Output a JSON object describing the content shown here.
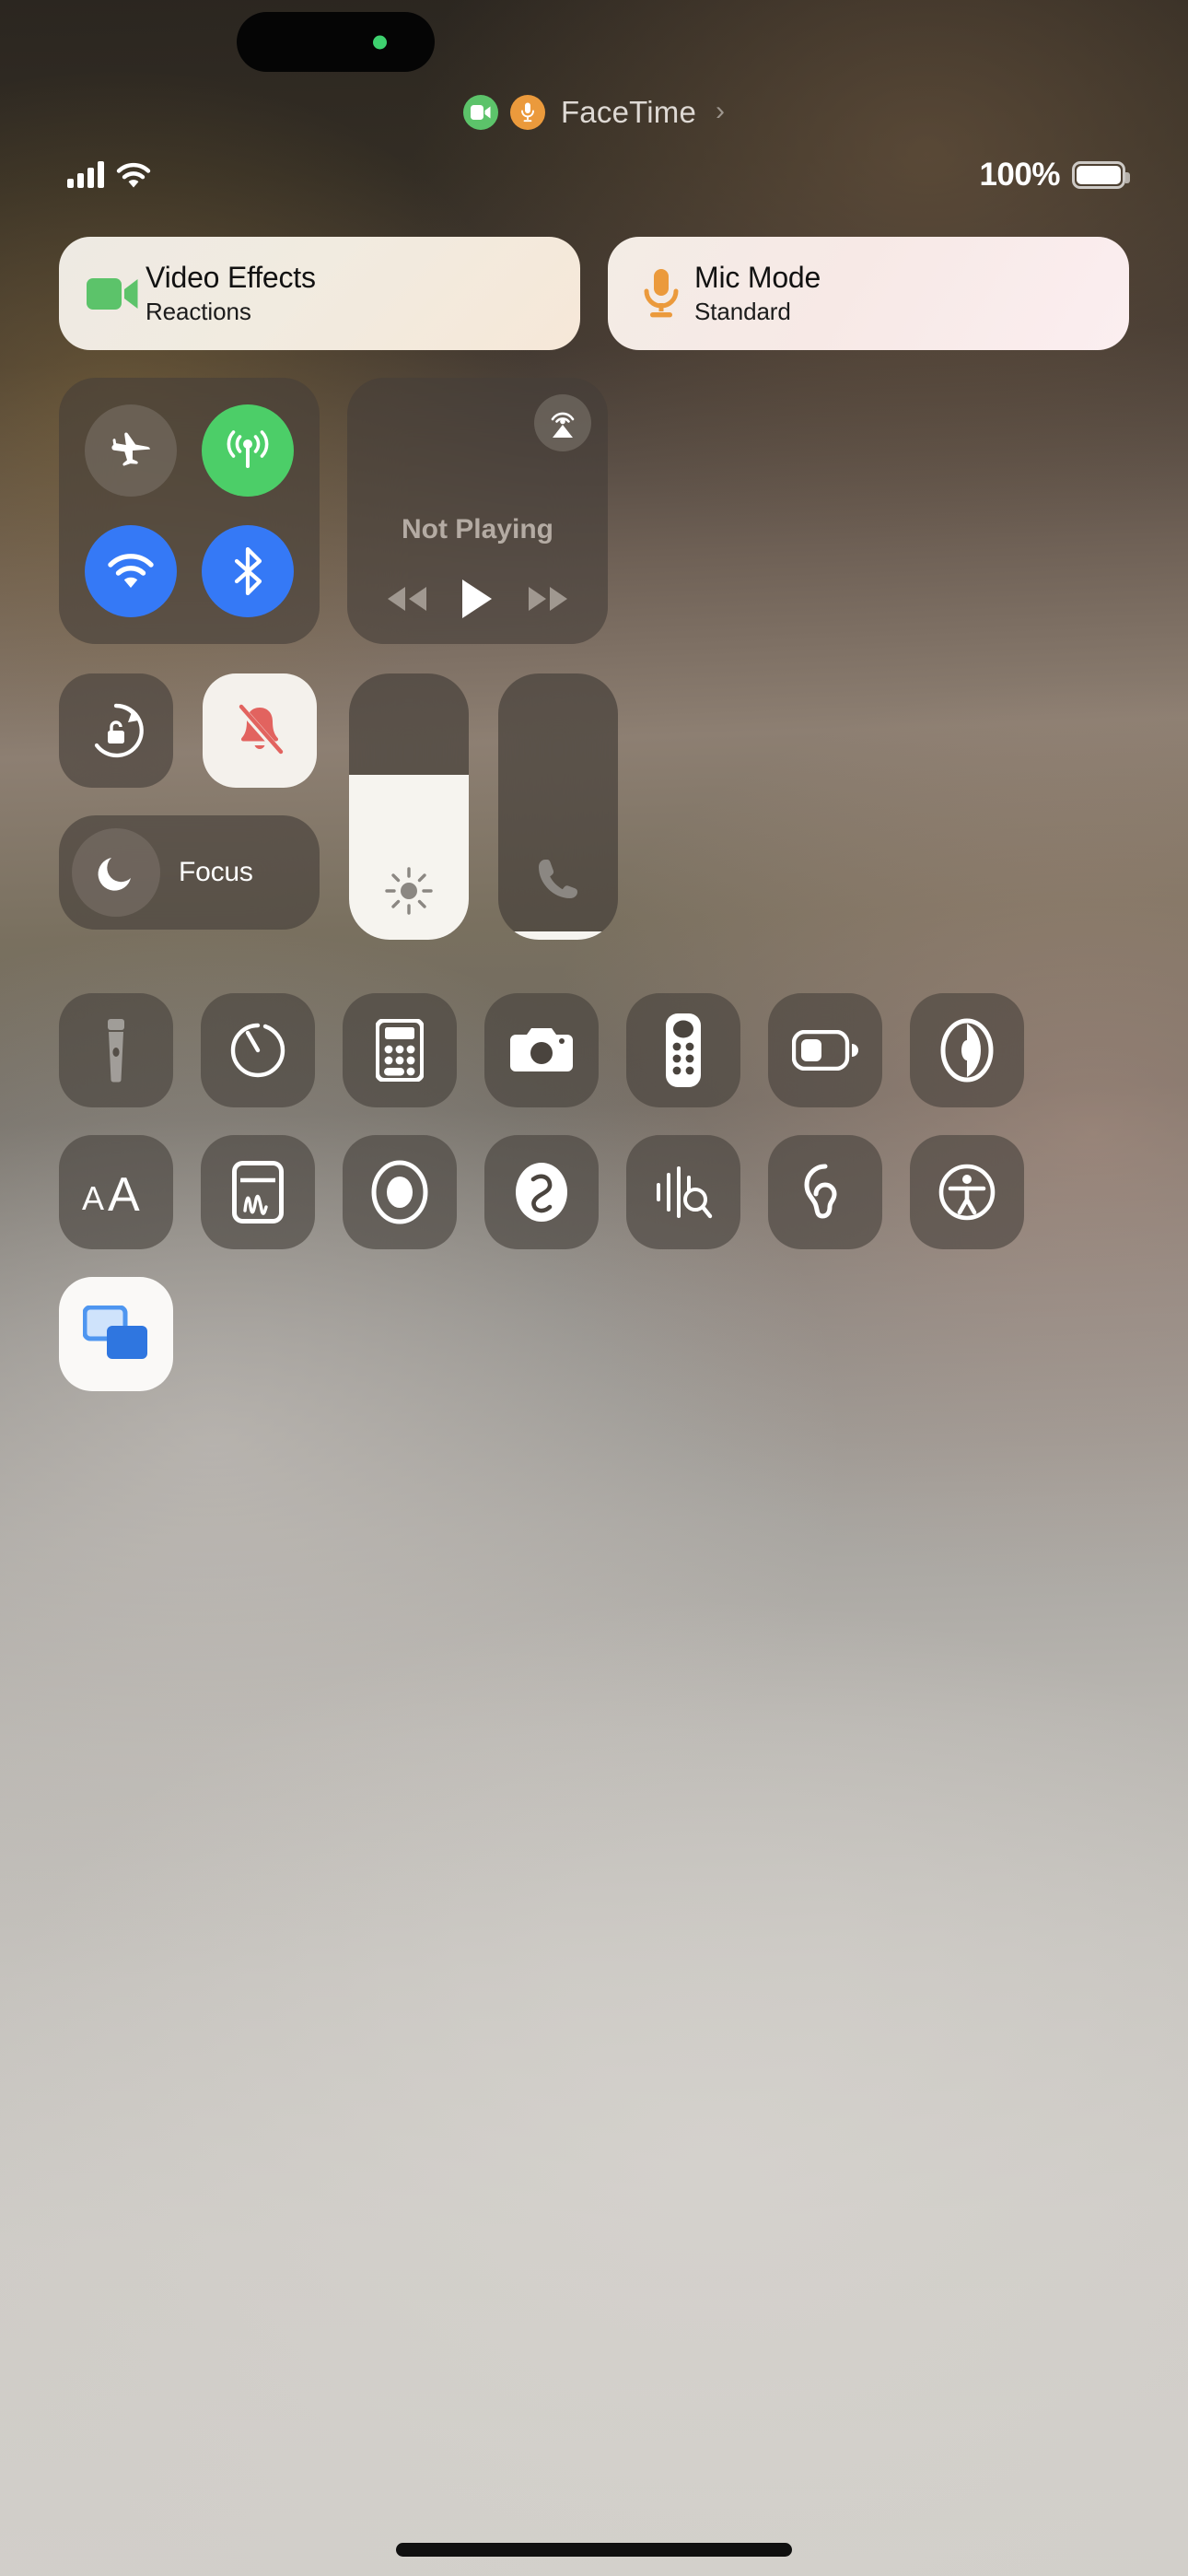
{
  "device": {
    "status_bar": {
      "signal_icon": "cellular-bars-icon",
      "signal_bars": 4,
      "wifi_icon": "wifi-icon",
      "battery_percent": "100%",
      "battery_icon": "battery-full-icon",
      "battery_level": 100
    },
    "dynamic_island": {
      "indicator": "camera-active-dot",
      "indicator_color": "#3ed16f"
    },
    "home_indicator": "home-indicator-bar"
  },
  "live_activity": {
    "app_name": "FaceTime",
    "camera_icon": "video-camera-icon",
    "camera_color": "#5cc36a",
    "mic_icon": "microphone-icon",
    "mic_color": "#eb9a3c",
    "chevron": "›"
  },
  "call_controls": [
    {
      "id": "video-effects",
      "title": "Video Effects",
      "subtitle": "Reactions",
      "icon": "video-camera-icon",
      "icon_color": "#5cc36a"
    },
    {
      "id": "mic-mode",
      "title": "Mic Mode",
      "subtitle": "Standard",
      "icon": "microphone-icon",
      "icon_color": "#eb9a3c"
    }
  ],
  "connectivity": {
    "toggles": [
      {
        "id": "airplane-mode",
        "label": "Airplane Mode",
        "icon": "airplane-icon",
        "state": "off",
        "color": "#847c74"
      },
      {
        "id": "cellular-data",
        "label": "Cellular Data",
        "icon": "cellular-antenna-icon",
        "state": "on",
        "color": "#4cce68"
      },
      {
        "id": "wifi",
        "label": "Wi-Fi",
        "icon": "wifi-icon",
        "state": "on",
        "color": "#3579f6"
      },
      {
        "id": "bluetooth",
        "label": "Bluetooth",
        "icon": "bluetooth-icon",
        "state": "on",
        "color": "#3579f6"
      }
    ]
  },
  "media_player": {
    "status_text": "Not Playing",
    "airplay_icon": "airplay-audio-icon",
    "controls": [
      {
        "id": "rewind",
        "icon": "rewind-icon"
      },
      {
        "id": "play",
        "icon": "play-icon"
      },
      {
        "id": "fast-forward",
        "icon": "fast-forward-icon"
      }
    ]
  },
  "toggles": {
    "rotation_lock": {
      "label": "Rotation Lock",
      "icon": "rotation-lock-icon",
      "state": "off"
    },
    "silent_mode": {
      "label": "Silent Mode",
      "icon": "bell-slash-icon",
      "state": "on",
      "icon_color": "#e2635f"
    }
  },
  "focus": {
    "label": "Focus",
    "icon": "moon-icon",
    "state": "off"
  },
  "sliders": [
    {
      "id": "brightness",
      "label": "Brightness",
      "icon": "sun-icon",
      "value_percent": 62
    },
    {
      "id": "volume",
      "label": "Volume",
      "icon": "phone-handset-icon",
      "value_percent": 3
    }
  ],
  "shortcuts": [
    {
      "id": "flashlight",
      "label": "Flashlight",
      "icon": "flashlight-icon",
      "state": "off"
    },
    {
      "id": "timer",
      "label": "Timer",
      "icon": "timer-icon",
      "state": "off"
    },
    {
      "id": "calculator",
      "label": "Calculator",
      "icon": "calculator-icon",
      "state": "off"
    },
    {
      "id": "camera",
      "label": "Camera",
      "icon": "camera-icon",
      "state": "off"
    },
    {
      "id": "apple-tv-remote",
      "label": "Apple TV Remote",
      "icon": "tv-remote-icon",
      "state": "off"
    },
    {
      "id": "low-power-mode",
      "label": "Low Power Mode",
      "icon": "battery-icon",
      "state": "off"
    },
    {
      "id": "dark-mode",
      "label": "Dark Mode",
      "icon": "dark-mode-icon",
      "state": "off"
    },
    {
      "id": "text-size",
      "label": "Text Size",
      "icon": "text-size-icon",
      "state": "off"
    },
    {
      "id": "quick-note",
      "label": "Quick Note",
      "icon": "quick-note-icon",
      "state": "off"
    },
    {
      "id": "screen-recording",
      "label": "Screen Recording",
      "icon": "screen-record-icon",
      "state": "off"
    },
    {
      "id": "shazam",
      "label": "Music Recognition",
      "icon": "shazam-icon",
      "state": "off"
    },
    {
      "id": "sound-recognition",
      "label": "Sound Recognition",
      "icon": "sound-recognition-icon",
      "state": "off"
    },
    {
      "id": "hearing",
      "label": "Hearing",
      "icon": "ear-icon",
      "state": "off"
    },
    {
      "id": "accessibility",
      "label": "Accessibility Shortcuts",
      "icon": "accessibility-icon",
      "state": "off"
    },
    {
      "id": "screen-mirroring",
      "label": "Screen Mirroring",
      "icon": "screen-mirroring-icon",
      "state": "on"
    }
  ]
}
